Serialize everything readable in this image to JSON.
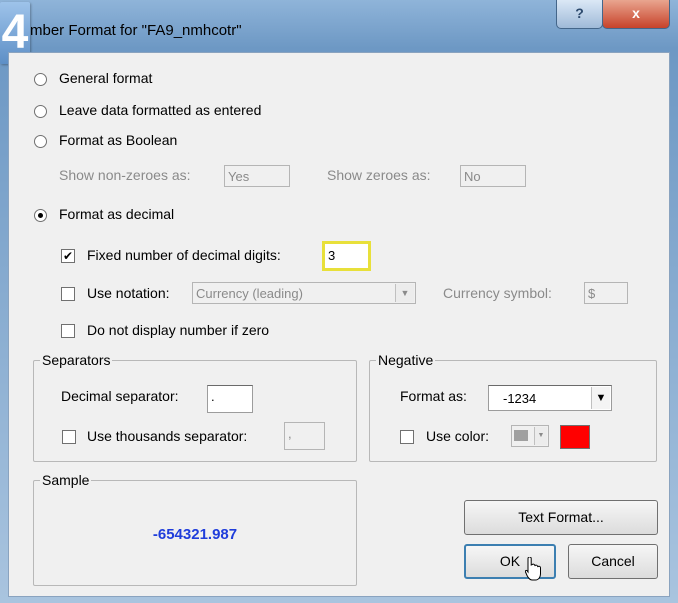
{
  "window": {
    "title": "mber Format for \"FA9_nmhcotr\"",
    "step_badge": "4",
    "help_glyph": "?",
    "close_glyph": "x"
  },
  "format": {
    "general": "General format",
    "leave": "Leave data formatted as entered",
    "boolean": "Format as Boolean",
    "show_nonzero_label": "Show non-zeroes as:",
    "show_nonzero_value": "Yes",
    "show_zero_label": "Show zeroes as:",
    "show_zero_value": "No",
    "decimal": "Format as decimal",
    "selected": "decimal"
  },
  "decimal": {
    "fixed_label": "Fixed number of decimal digits:",
    "fixed_checked": true,
    "fixed_value": "3",
    "notation_label": "Use notation:",
    "notation_checked": false,
    "notation_value": "Currency (leading)",
    "currency_symbol_label": "Currency symbol:",
    "currency_symbol_value": "$",
    "no_zero_label": "Do not display number if zero",
    "no_zero_checked": false
  },
  "separators": {
    "legend": "Separators",
    "decimal_label": "Decimal separator:",
    "decimal_value": ".",
    "thousands_label": "Use thousands separator:",
    "thousands_checked": false,
    "thousands_value": ","
  },
  "negative": {
    "legend": "Negative",
    "format_label": "Format as:",
    "format_value": "-1234",
    "color_label": "Use color:",
    "color_checked": false,
    "swatch_color": "#ff0000"
  },
  "sample": {
    "legend": "Sample",
    "value": "-654321.987",
    "value_color": "#1f3ddb"
  },
  "buttons": {
    "text_format": "Text Format...",
    "ok": "OK",
    "cancel": "Cancel"
  }
}
